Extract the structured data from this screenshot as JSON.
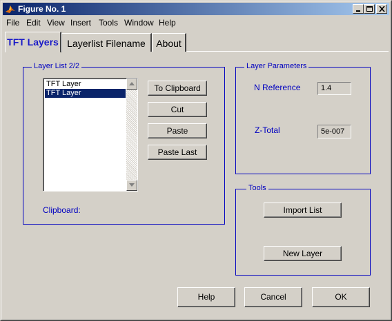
{
  "window": {
    "title": "Figure No. 1"
  },
  "menu": {
    "items": [
      "File",
      "Edit",
      "View",
      "Insert",
      "Tools",
      "Window",
      "Help"
    ]
  },
  "tabs": [
    {
      "label": "TFT Layers",
      "active": true
    },
    {
      "label": "Layerlist Filename",
      "active": false
    },
    {
      "label": "About",
      "active": false
    }
  ],
  "layer_list": {
    "title": "Layer List 2/2",
    "items": [
      {
        "label": "TFT Layer",
        "selected": false
      },
      {
        "label": "TFT Layer",
        "selected": true
      }
    ],
    "clipboard_label": "Clipboard:"
  },
  "list_actions": {
    "to_clipboard": "To Clipboard",
    "cut": "Cut",
    "paste": "Paste",
    "paste_last": "Paste Last"
  },
  "layer_parameters": {
    "title": "Layer Parameters",
    "n_reference_label": "N Reference",
    "n_reference_value": "1.4",
    "z_total_label": "Z-Total",
    "z_total_value": "5e-007"
  },
  "tools": {
    "title": "Tools",
    "import_list": "Import List",
    "new_layer": "New Layer"
  },
  "footer": {
    "help": "Help",
    "cancel": "Cancel",
    "ok": "OK"
  },
  "colors": {
    "accent_blue": "#0000c0",
    "title_bar": "#0a246a",
    "face": "#d4d0c8",
    "selection": "#0a246a"
  }
}
